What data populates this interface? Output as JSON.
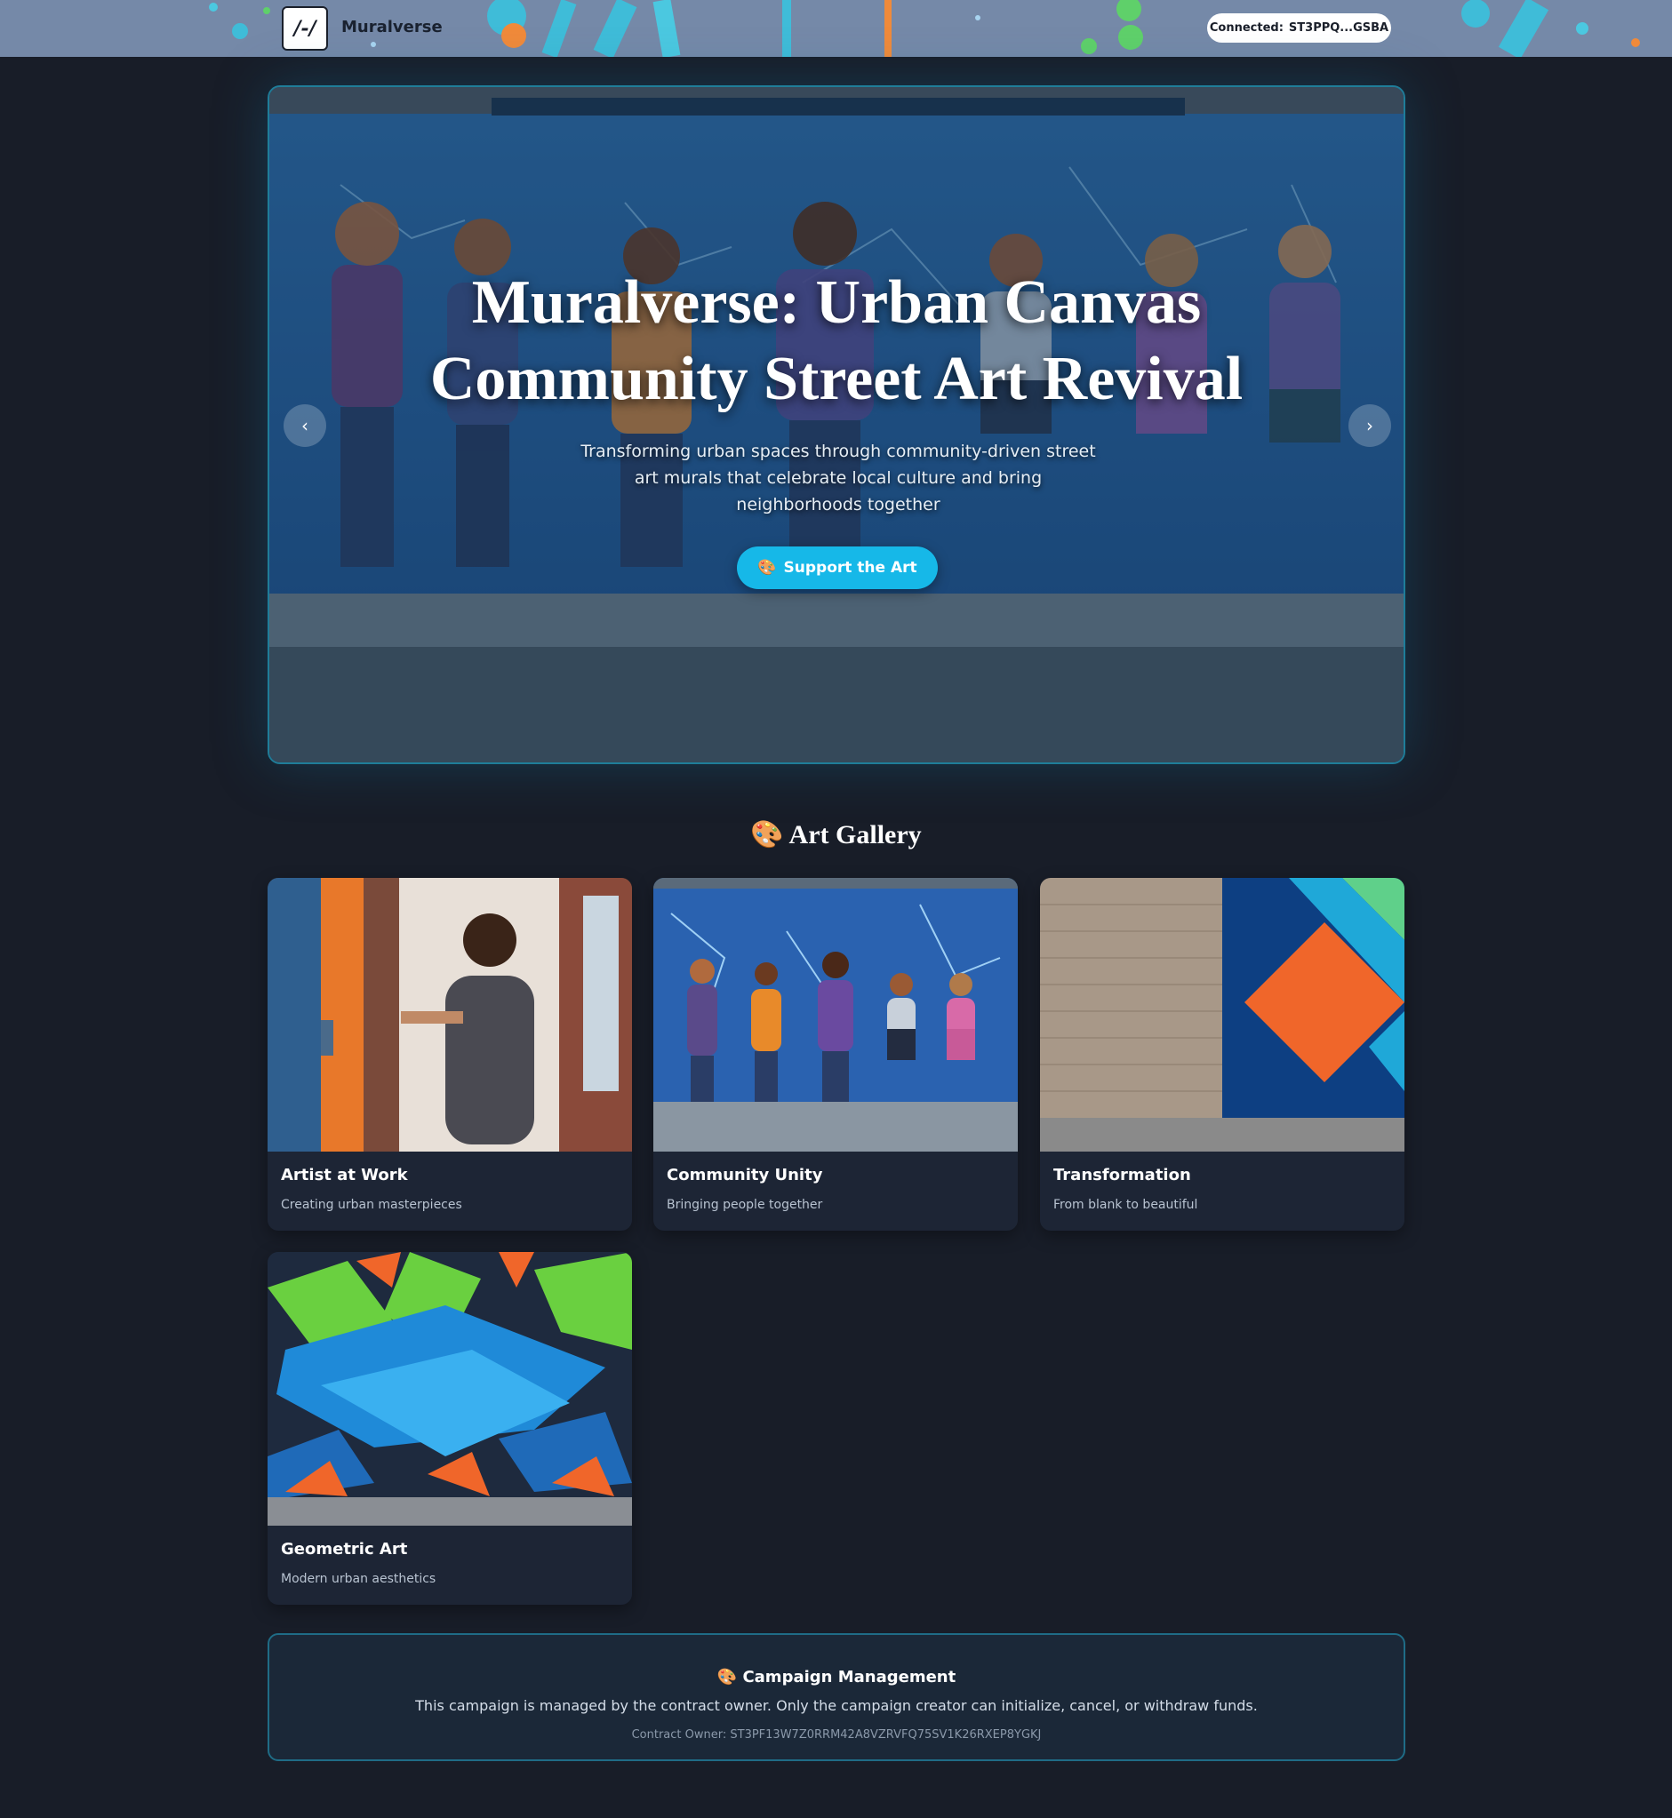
{
  "header": {
    "logo_glyph": "/-/",
    "brand": "Muralverse",
    "wallet_label": "Connected:",
    "wallet_address": "ST3PPQ...GSBA"
  },
  "hero": {
    "title_line1": "Muralverse: Urban Canvas",
    "title_line2": "Community Street Art Revival",
    "subtitle": "Transforming urban spaces through community-driven street art murals that celebrate local culture and bring neighborhoods together",
    "cta_icon": "🎨",
    "cta_label": "Support the Art",
    "prev_glyph": "‹",
    "next_glyph": "›"
  },
  "gallery": {
    "icon": "🎨",
    "title": "Art Gallery",
    "items": [
      {
        "title": "Artist at Work",
        "description": "Creating urban masterpieces"
      },
      {
        "title": "Community Unity",
        "description": "Bringing people together"
      },
      {
        "title": "Transformation",
        "description": "From blank to beautiful"
      },
      {
        "title": "Geometric Art",
        "description": "Modern urban aesthetics"
      }
    ]
  },
  "campaign": {
    "icon": "🎨",
    "title": "Campaign Management",
    "text": "This campaign is managed by the contract owner. Only the campaign creator can initialize, cancel, or withdraw funds.",
    "owner": "Contract Owner: ST3PF13W7Z0RRM42A8VZRVFQ75SV1K26RXEP8YGKJ"
  },
  "colors": {
    "background": "#181d28",
    "accent": "#16b8e8",
    "header": "#7589a8",
    "card": "#1d2535"
  }
}
